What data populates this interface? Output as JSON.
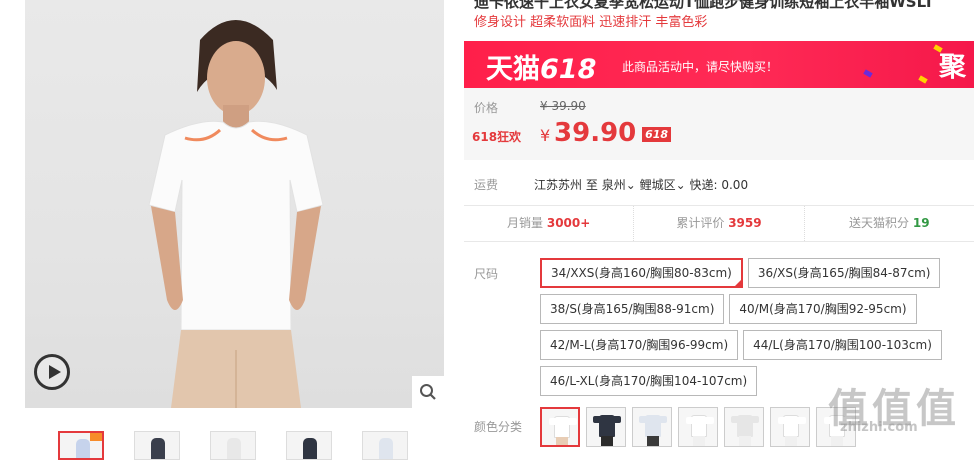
{
  "product": {
    "title": "迪卡侬速干上衣女夏季宽松运动T恤跑步健身训练短袖上衣半袖WSLT",
    "subtitle": "修身设计 超柔软面料 迅速排汗 丰富色彩"
  },
  "promo_banner": {
    "logo_text": "天猫",
    "logo_number": "618",
    "message": "此商品活动中，请尽快购买！",
    "right_text": "聚",
    "background": "#ff2a55"
  },
  "price": {
    "label": "价格",
    "original": "¥ 39.90",
    "promo_label": "618狂欢",
    "currency": "¥",
    "amount": "39.90",
    "badge": "618",
    "accent_color": "#e4393c"
  },
  "shipping": {
    "label": "运费",
    "origin": "江苏苏州",
    "to": "至",
    "city": "泉州",
    "district": "鲤城区",
    "fee": "快递: 0.00"
  },
  "stats": [
    {
      "label": "月销量",
      "value": "3000+"
    },
    {
      "label": "累计评价",
      "value": "3959"
    },
    {
      "label": "送天猫积分",
      "value": "19"
    }
  ],
  "sizes": {
    "label": "尺码",
    "options": [
      "34/XXS(身高160/胸围80-83cm)",
      "36/XS(身高165/胸围84-87cm)",
      "38/S(身高165/胸围88-91cm)",
      "40/M(身高170/胸围92-95cm)",
      "42/M-L(身高170/胸围96-99cm)",
      "44/L(身高170/胸围100-103cm)",
      "46/L-XL(身高170/胸围104-107cm)"
    ],
    "selected": "34/XXS(身高160/胸围80-83cm)"
  },
  "colors": {
    "label": "颜色分类",
    "swatches": [
      "#ffffff",
      "#2f3542",
      "#dfe5ee",
      "#ffffff",
      "#e6e6e6",
      "#ffffff",
      "#ffffff"
    ]
  },
  "watermark": {
    "glyphs": "值值值",
    "domain": "zhizhi.com"
  }
}
